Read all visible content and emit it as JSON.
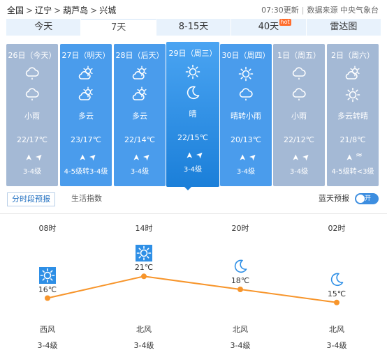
{
  "breadcrumb": {
    "items": [
      "全国",
      "辽宁",
      "葫芦岛",
      "兴城"
    ],
    "separator": ">"
  },
  "update": {
    "time": "07:30更新",
    "source": "数据来源 中央气象台"
  },
  "tabs": [
    {
      "label": "今天",
      "active": false
    },
    {
      "label": "7天",
      "active": true
    },
    {
      "label": "8-15天",
      "active": false
    },
    {
      "label": "40天",
      "active": false,
      "badge": "hot"
    },
    {
      "label": "雷达图",
      "active": false
    }
  ],
  "days": [
    {
      "label": "26日（今天）",
      "icons": [
        "rain-cloud-icon",
        "rain-cloud-icon"
      ],
      "weather": "小雨",
      "temp": "22/17℃",
      "wind": [
        "➤",
        "➤"
      ],
      "level": "3-4级",
      "style": "past"
    },
    {
      "label": "27日（明天）",
      "icons": [
        "partly-cloudy-icon",
        "partly-cloudy-icon"
      ],
      "weather": "多云",
      "temp": "23/17℃",
      "wind": [
        "➤",
        "➤"
      ],
      "level": "4-5级转3-4级",
      "style": "future"
    },
    {
      "label": "28日（后天）",
      "icons": [
        "partly-cloudy-icon",
        "partly-cloudy-icon"
      ],
      "weather": "多云",
      "temp": "22/14℃",
      "wind": [
        "➤",
        "➤"
      ],
      "level": "3-4级",
      "style": "future"
    },
    {
      "label": "29日（周三）",
      "icons": [
        "sun-icon",
        "moon-icon"
      ],
      "weather": "晴",
      "temp": "22/15℃",
      "wind": [
        "➤",
        "➤"
      ],
      "level": "3-4级",
      "style": "today"
    },
    {
      "label": "30日（周四）",
      "icons": [
        "sun-icon",
        "rain-cloud-icon"
      ],
      "weather": "晴转小雨",
      "temp": "20/13℃",
      "wind": [
        "➤",
        "➤"
      ],
      "level": "3-4级",
      "style": "future"
    },
    {
      "label": "1日（周五）",
      "icons": [
        "rain-cloud-icon",
        "rain-cloud-icon"
      ],
      "weather": "小雨",
      "temp": "22/12℃",
      "wind": [
        "➤",
        "➤"
      ],
      "level": "3-4级",
      "style": "far"
    },
    {
      "label": "2日（周六）",
      "icons": [
        "partly-cloudy-icon",
        "sun-icon"
      ],
      "weather": "多云转晴",
      "temp": "21/8℃",
      "wind": [
        "➤",
        "≈"
      ],
      "level": "4-5级转<3级",
      "style": "far"
    }
  ],
  "subtabs": {
    "active": "分时段预报",
    "other": "生活指数"
  },
  "bluesky": {
    "label": "蓝天预报",
    "toggle": "开"
  },
  "chart_data": {
    "type": "line",
    "x": [
      "08时",
      "14时",
      "20时",
      "02时"
    ],
    "temps": [
      16,
      21,
      18,
      15
    ],
    "temp_labels": [
      "16℃",
      "21℃",
      "18℃",
      "15℃"
    ],
    "icons": [
      "sun-icon",
      "sun-icon",
      "moon-icon",
      "moon-icon"
    ],
    "wind_dir": [
      "西风",
      "北风",
      "北风",
      "北风"
    ],
    "wind_level": [
      "3-4级",
      "3-4级",
      "3-4级",
      "3-4级"
    ],
    "line_color": "#f7952b"
  }
}
